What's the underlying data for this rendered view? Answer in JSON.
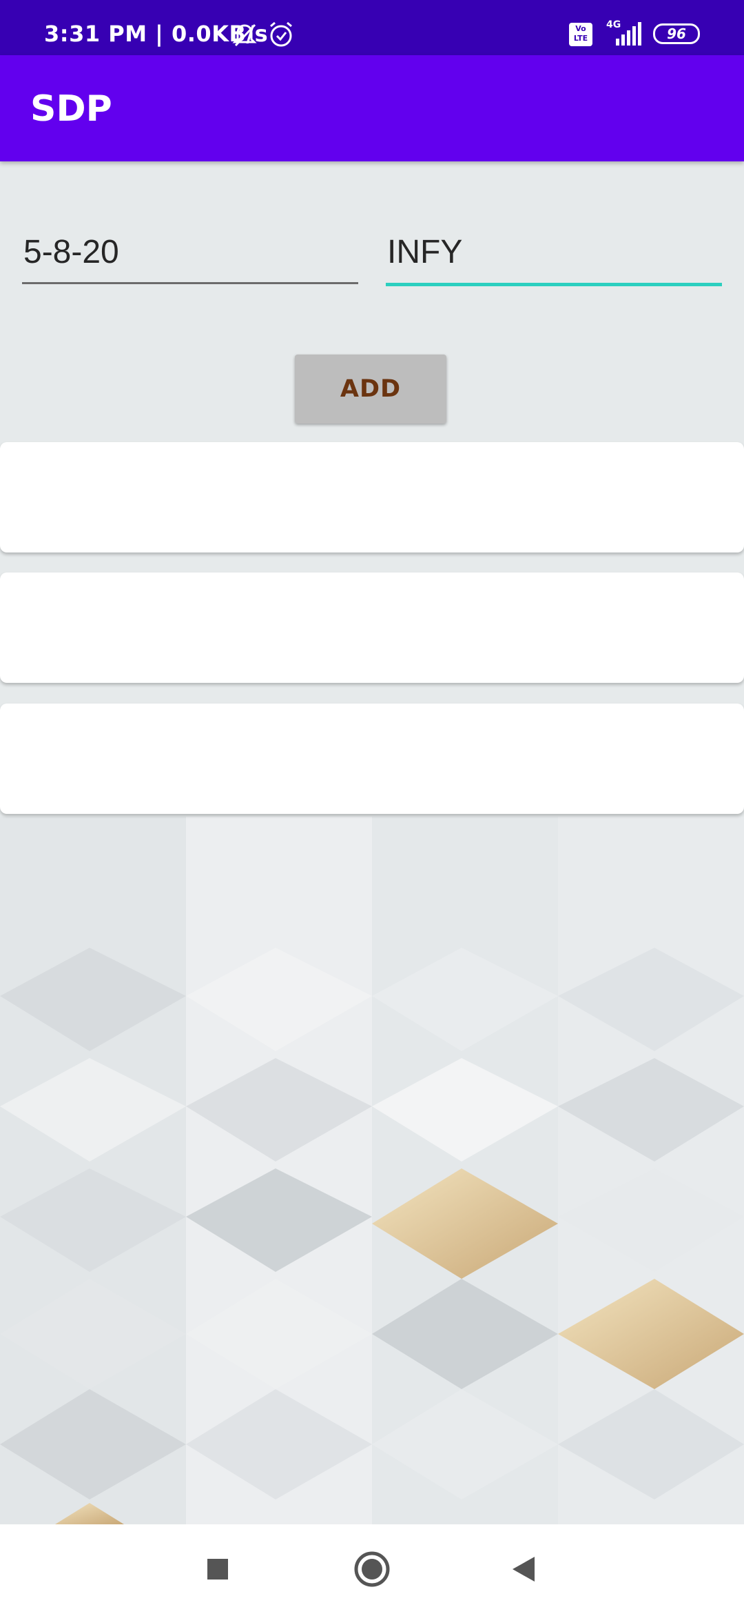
{
  "status_bar": {
    "time_text": "3:31 PM | 0.0KB/s",
    "network_label": "4G",
    "volte_label": "Vo LTE",
    "battery_level": "96"
  },
  "app_bar": {
    "title": "SDP"
  },
  "form": {
    "date_value": "5-8-20",
    "symbol_value": "INFY",
    "add_label": "ADD"
  },
  "cards_count_visible": 3,
  "icons": {
    "mute": "bell-off-icon",
    "alarm": "alarm-icon",
    "signal": "signal-icon",
    "battery": "battery-icon",
    "recents": "square-icon",
    "home": "circle-icon",
    "back": "triangle-back-icon"
  },
  "colors": {
    "status_bar": "#3700b3",
    "app_bar": "#6200ee",
    "focused_underline": "#2ccfbf",
    "button_text": "#6b3410"
  }
}
